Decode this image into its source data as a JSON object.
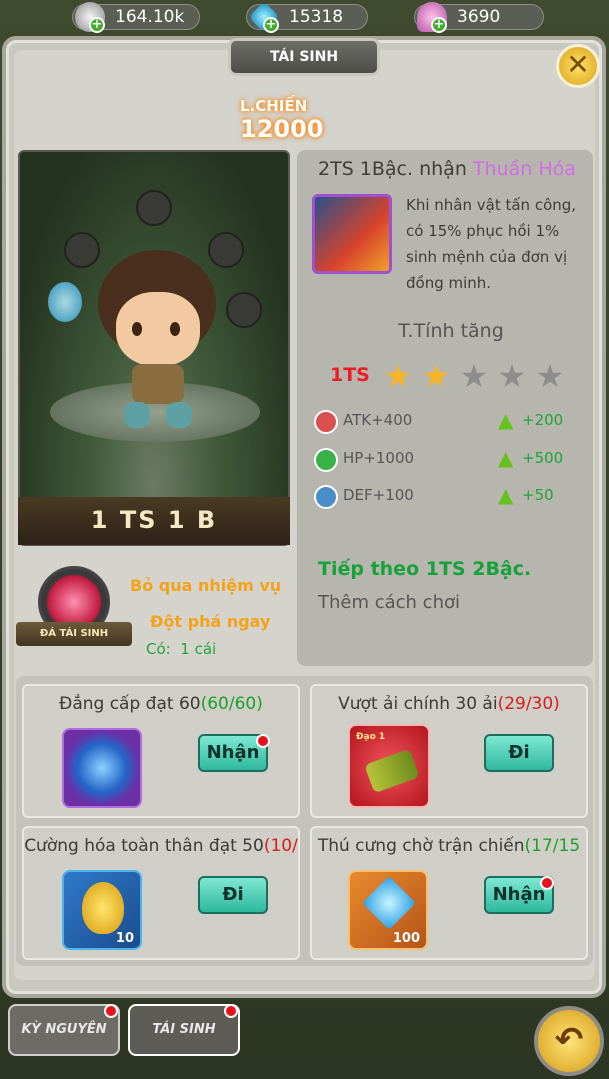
{
  "currency": {
    "silver": {
      "value": "164.10k",
      "icon": "silver-coin-icon"
    },
    "gem": {
      "value": "15318",
      "icon": "diamond-icon"
    },
    "shell": {
      "value": "3690",
      "icon": "shell-icon"
    }
  },
  "header": {
    "title": "TÁI SINH",
    "close_icon": "close-icon"
  },
  "combat": {
    "label": "L.CHIẾN",
    "value": "12000"
  },
  "hero": {
    "name": "1 TS 1 B"
  },
  "rebirth": {
    "title_prefix": "2TS 1Bậc. nhận ",
    "title_highlight": "Thuần Hóa",
    "skill_desc": "Khi nhân vật tấn công, có 15% phục hồi 1% sinh mệnh của đơn vị đồng minh.",
    "attr_header": "T.Tính tăng",
    "level_label": "1TS",
    "stars_filled": 2,
    "stars_total": 5,
    "stats": [
      {
        "label": "ATK+400",
        "bonus": "+200",
        "icon": "attack-icon",
        "color": "#d9504f"
      },
      {
        "label": "HP+1000",
        "bonus": "+500",
        "icon": "heart-icon",
        "color": "#39b24a"
      },
      {
        "label": "DEF+100",
        "bonus": "+50",
        "icon": "shield-icon",
        "color": "#4a8ec9"
      }
    ],
    "next_label": "Tiếp theo 1TS 2Bậc.",
    "more_label": "Thêm cách chơi"
  },
  "skip": {
    "badge_label": "ĐÁ TÁI SINH",
    "line1": "Bỏ qua nhiệm vụ",
    "line2": "Đột phá ngay",
    "have_label": "Có:",
    "have_count": "1 cái"
  },
  "tasks": [
    {
      "title": "Đẳng cấp đạt 60",
      "progress": "(60/60)",
      "progress_color": "#1f9e2b",
      "button": "Nhận",
      "has_dot": true,
      "icon": "blue-orb-icon",
      "qty": ""
    },
    {
      "title": "Vượt ải chính 30 ải",
      "progress": "(29/30)",
      "progress_color": "#d91d1d",
      "button": "Đi",
      "has_dot": false,
      "icon": "bamboo-item-icon",
      "qty": "",
      "badge": "Đạo 1"
    },
    {
      "title": "Cường hóa toàn thân đạt 50",
      "progress": "(10/",
      "progress_color": "#d91d1d",
      "button": "Đi",
      "has_dot": false,
      "icon": "gold-stone-icon",
      "qty": "10"
    },
    {
      "title": "Thú cưng chờ trận chiến",
      "progress": "(17/15",
      "progress_color": "#1f9e2b",
      "button": "Nhận",
      "has_dot": true,
      "icon": "blue-diamond-icon",
      "qty": "100"
    }
  ],
  "tabs": [
    {
      "label": "KỲ NGUYÊN"
    },
    {
      "label": "TÁI SINH"
    }
  ],
  "back_icon": "back-arrow-icon"
}
